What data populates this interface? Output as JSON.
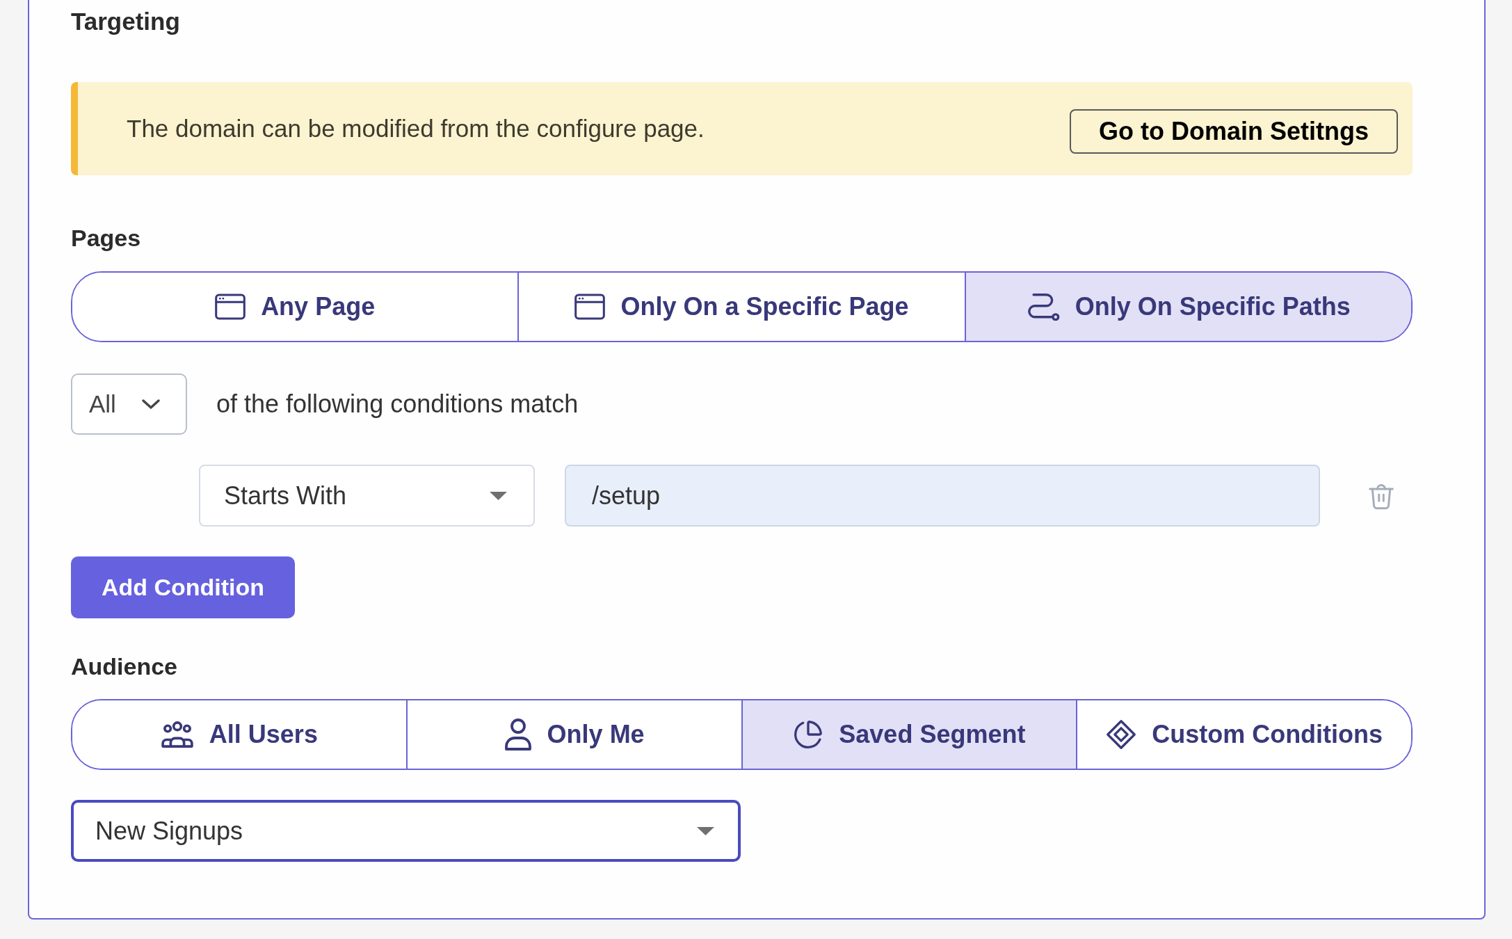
{
  "section": {
    "title": "Targeting"
  },
  "notice": {
    "text": "The domain can be modified from the configure page.",
    "button": "Go to Domain Setitngs"
  },
  "pages": {
    "label": "Pages",
    "options": [
      {
        "label": "Any Page",
        "selected": false
      },
      {
        "label": "Only On a Specific Page",
        "selected": false
      },
      {
        "label": "Only On Specific Paths",
        "selected": true
      }
    ]
  },
  "match": {
    "quantifier": "All",
    "text": "of the following conditions match"
  },
  "conditions": [
    {
      "operator": "Starts With",
      "value": "/setup"
    }
  ],
  "add_condition_button": "Add Condition",
  "audience": {
    "label": "Audience",
    "options": [
      {
        "label": "All Users",
        "selected": false
      },
      {
        "label": "Only Me",
        "selected": false
      },
      {
        "label": "Saved Segment",
        "selected": true
      },
      {
        "label": "Custom Conditions",
        "selected": false
      }
    ],
    "segment": {
      "value": "New Signups",
      "focused": true
    }
  }
}
